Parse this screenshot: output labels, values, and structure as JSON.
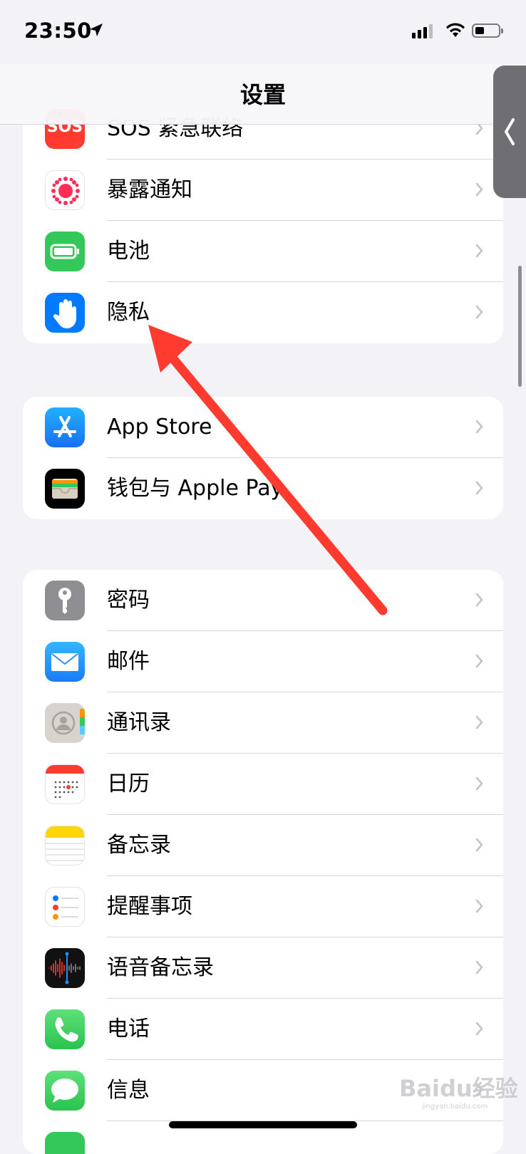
{
  "status_bar": {
    "time": "23:50"
  },
  "nav": {
    "title": "设置"
  },
  "groups": [
    {
      "items": [
        {
          "label": "SOS 紧急联络",
          "icon": "sos-icon",
          "icon_text": "SOS",
          "color": "#ff3b30"
        },
        {
          "label": "暴露通知",
          "icon": "exposure-notification-icon"
        },
        {
          "label": "电池",
          "icon": "battery-icon",
          "color": "#34c759"
        },
        {
          "label": "隐私",
          "icon": "privacy-hand-icon",
          "color": "#007aff"
        }
      ]
    },
    {
      "items": [
        {
          "label": "App Store",
          "icon": "app-store-icon",
          "color": "#1a8cff"
        },
        {
          "label": "钱包与 Apple Pay",
          "icon": "wallet-icon",
          "color": "#000000"
        }
      ]
    },
    {
      "items": [
        {
          "label": "密码",
          "icon": "key-icon",
          "color": "#8e8e93"
        },
        {
          "label": "邮件",
          "icon": "mail-icon",
          "color": "#1e90ff"
        },
        {
          "label": "通讯录",
          "icon": "contacts-icon",
          "color": "#d8d8d0"
        },
        {
          "label": "日历",
          "icon": "calendar-icon",
          "color": "#ffffff"
        },
        {
          "label": "备忘录",
          "icon": "notes-icon",
          "color": "#ffd60a"
        },
        {
          "label": "提醒事项",
          "icon": "reminders-icon",
          "color": "#ffffff"
        },
        {
          "label": "语音备忘录",
          "icon": "voice-memos-icon",
          "color": "#000000"
        },
        {
          "label": "电话",
          "icon": "phone-icon",
          "color": "#34c759"
        },
        {
          "label": "信息",
          "icon": "messages-icon",
          "color": "#34c759"
        }
      ]
    }
  ],
  "annotation": {
    "arrow_color": "#ff3b30"
  },
  "watermark": {
    "text": "Baidu经验",
    "sub": "jingyan.baidu.com"
  }
}
